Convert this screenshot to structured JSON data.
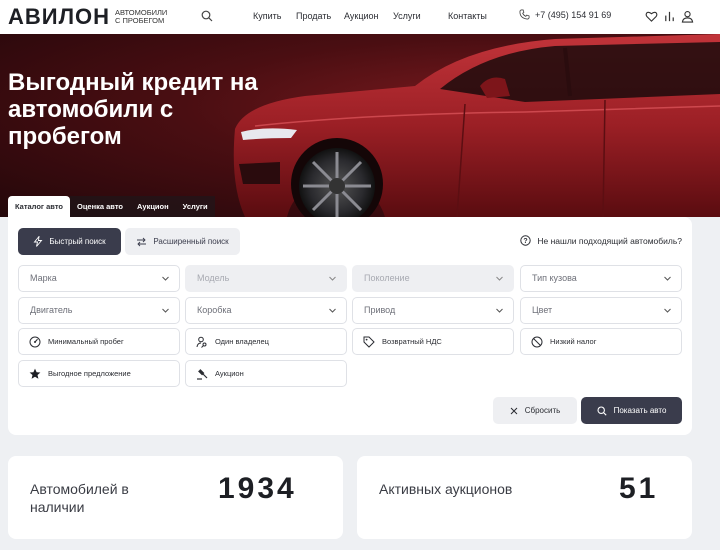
{
  "header": {
    "logo_text": "АВИЛОН",
    "logo_sub": "АВТОМОБИЛИ С ПРОБЕГОМ",
    "nav": [
      "Купить",
      "Продать",
      "Аукцион",
      "Услуги",
      "Контакты"
    ],
    "phone": "+7 (495) 154 91 69"
  },
  "hero": {
    "title": "Выгодный кредит на автомобили с пробегом",
    "car_color": "#a5262c"
  },
  "tabs": [
    "Каталог авто",
    "Оценка авто",
    "Аукцион",
    "Услуги"
  ],
  "active_tab": "Каталог авто",
  "filter": {
    "mode_quick": "Быстрый поиск",
    "mode_advanced": "Расширенный поиск",
    "help_text": "Не нашли подходящий автомобиль?",
    "selects": [
      {
        "label": "Марка",
        "disabled": false
      },
      {
        "label": "Модель",
        "disabled": true
      },
      {
        "label": "Поколение",
        "disabled": true
      },
      {
        "label": "Тип кузова",
        "disabled": false
      },
      {
        "label": "Двигатель",
        "disabled": false
      },
      {
        "label": "Коробка",
        "disabled": false
      },
      {
        "label": "Привод",
        "disabled": false
      },
      {
        "label": "Цвет",
        "disabled": false
      }
    ],
    "chips": [
      {
        "label": "Минимальный пробег",
        "icon": "gauge-icon"
      },
      {
        "label": "Один владелец",
        "icon": "person-key-icon"
      },
      {
        "label": "Возвратный НДС",
        "icon": "tag-icon"
      },
      {
        "label": "Низкий налог",
        "icon": "no-percent-icon"
      },
      {
        "label": "Выгодное предложение",
        "icon": "star-icon"
      },
      {
        "label": "Аукцион",
        "icon": "gavel-icon"
      }
    ],
    "reset_label": "Сбросить",
    "show_label": "Показать авто"
  },
  "stats": [
    {
      "label": "Автомобилей в наличии",
      "value": "1934"
    },
    {
      "label": "Активных аукционов",
      "value": "51"
    }
  ],
  "colors": {
    "accent_dark": "#3a3c4c",
    "logo_red": "#d8262f"
  }
}
